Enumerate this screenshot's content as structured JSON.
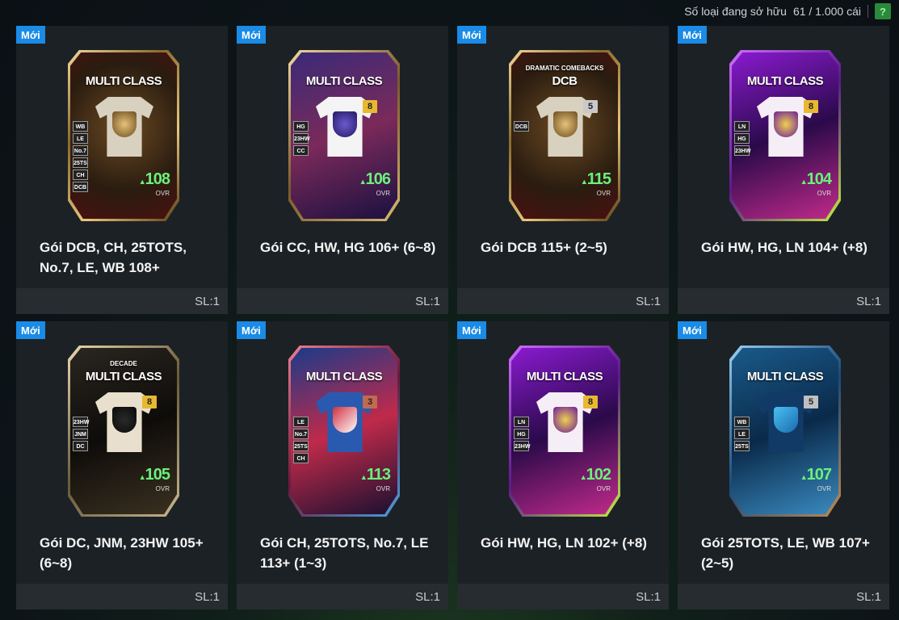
{
  "header": {
    "owned_label": "Số loại đang sở hữu",
    "owned_count": "61 / 1.000 cái",
    "help_label": "?"
  },
  "colors": {
    "new_badge": "#1a8be6",
    "ovr_green": "#6bf07a",
    "tile_bg": "#1c2125"
  },
  "packs": [
    {
      "badge": "Mới",
      "card_title": "MULTI CLASS",
      "card_subtitle": "",
      "level": "",
      "positions": [
        "WB",
        "LE",
        "No.7",
        "25TS",
        "CH",
        "DCB"
      ],
      "ovr": "108",
      "ovr_label": "OVR",
      "name": "Gói DCB, CH, 25TOTS, No.7, LE, WB 108+",
      "qty": "SL:1",
      "theme": "gold"
    },
    {
      "badge": "Mới",
      "card_title": "MULTI CLASS",
      "card_subtitle": "",
      "level": "8",
      "positions": [
        "HG",
        "23HW",
        "CC"
      ],
      "ovr": "106",
      "ovr_label": "OVR",
      "name": "Gói CC, HW, HG 106+ (6~8)",
      "qty": "SL:1",
      "theme": "purple"
    },
    {
      "badge": "Mới",
      "card_title": "DCB",
      "card_subtitle": "DRAMATIC COMEBACKS",
      "level": "5",
      "positions": [
        "DCB"
      ],
      "ovr": "115",
      "ovr_label": "OVR",
      "name": "Gói DCB 115+ (2~5)",
      "qty": "SL:1",
      "theme": "gold"
    },
    {
      "badge": "Mới",
      "card_title": "MULTI CLASS",
      "card_subtitle": "",
      "level": "8",
      "positions": [
        "LN",
        "HG",
        "23HW"
      ],
      "ovr": "104",
      "ovr_label": "OVR",
      "name": "Gói HW, HG, LN 104+ (+8)",
      "qty": "SL:1",
      "theme": "neon"
    },
    {
      "badge": "Mới",
      "card_title": "MULTI CLASS",
      "card_subtitle": "DECADE",
      "level": "8",
      "positions": [
        "23HW",
        "JNM",
        "DC"
      ],
      "ovr": "105",
      "ovr_label": "OVR",
      "name": "Gói DC, JNM, 23HW 105+ (6~8)",
      "qty": "SL:1",
      "theme": "decade"
    },
    {
      "badge": "Mới",
      "card_title": "MULTI CLASS",
      "card_subtitle": "",
      "level": "3",
      "positions": [
        "LE",
        "No.7",
        "25TS",
        "CH"
      ],
      "ovr": "113",
      "ovr_label": "OVR",
      "name": "Gói CH, 25TOTS, No.7, LE 113+ (1~3)",
      "qty": "SL:1",
      "theme": "red"
    },
    {
      "badge": "Mới",
      "card_title": "MULTI CLASS",
      "card_subtitle": "",
      "level": "8",
      "positions": [
        "LN",
        "HG",
        "23HW"
      ],
      "ovr": "102",
      "ovr_label": "OVR",
      "name": "Gói HW, HG, LN 102+ (+8)",
      "qty": "SL:1",
      "theme": "neon"
    },
    {
      "badge": "Mới",
      "card_title": "MULTI CLASS",
      "card_subtitle": "",
      "level": "5",
      "positions": [
        "WB",
        "LE",
        "25TS"
      ],
      "ovr": "107",
      "ovr_label": "OVR",
      "name": "Gói 25TOTS, LE, WB 107+ (2~5)",
      "qty": "SL:1",
      "theme": "blue"
    }
  ]
}
